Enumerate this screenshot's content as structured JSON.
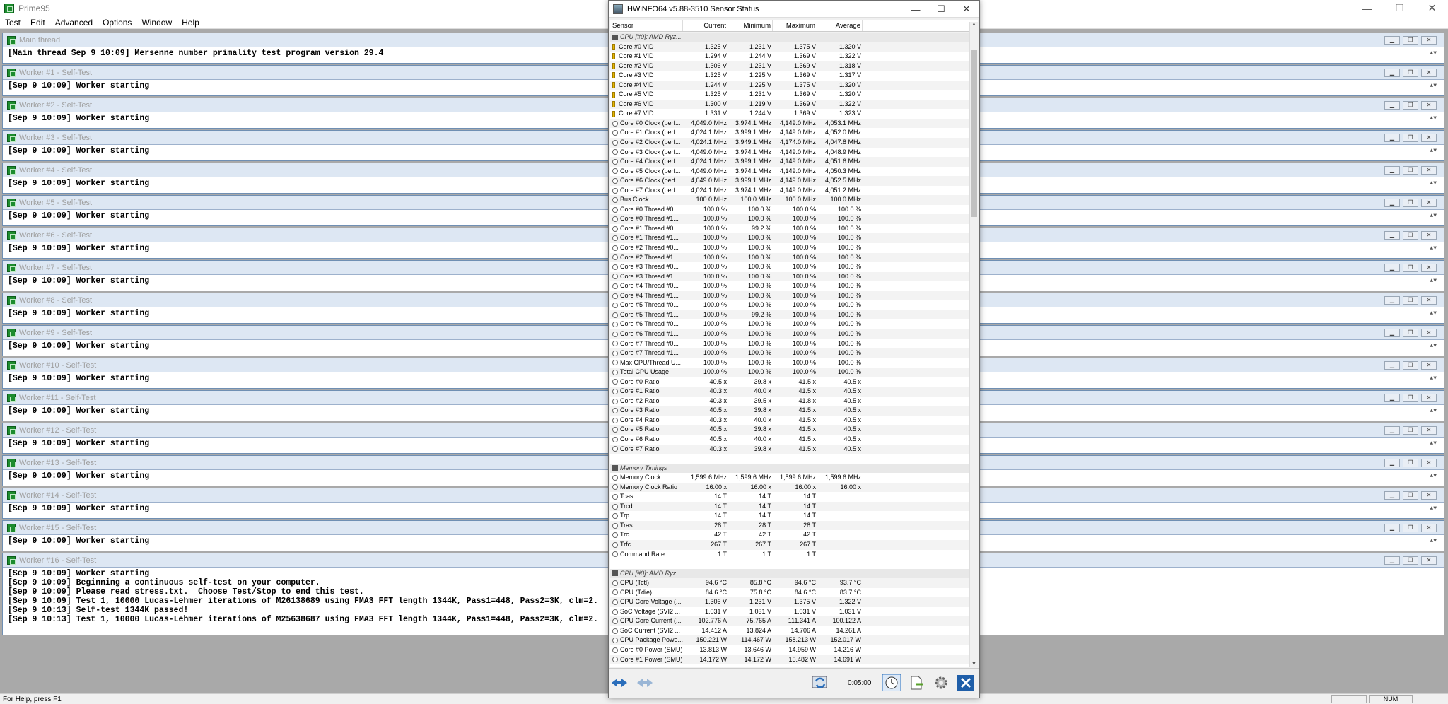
{
  "prime95": {
    "title": "Prime95",
    "menu": [
      "Test",
      "Edit",
      "Advanced",
      "Options",
      "Window",
      "Help"
    ],
    "windows": [
      {
        "title": "Main thread",
        "lines": [
          "[Main thread Sep 9 10:09] Mersenne number primality test program version 29.4"
        ]
      },
      {
        "title": "Worker #1 - Self-Test",
        "lines": [
          "[Sep 9 10:09] Worker starting"
        ]
      },
      {
        "title": "Worker #2 - Self-Test",
        "lines": [
          "[Sep 9 10:09] Worker starting"
        ]
      },
      {
        "title": "Worker #3 - Self-Test",
        "lines": [
          "[Sep 9 10:09] Worker starting"
        ]
      },
      {
        "title": "Worker #4 - Self-Test",
        "lines": [
          "[Sep 9 10:09] Worker starting"
        ]
      },
      {
        "title": "Worker #5 - Self-Test",
        "lines": [
          "[Sep 9 10:09] Worker starting"
        ]
      },
      {
        "title": "Worker #6 - Self-Test",
        "lines": [
          "[Sep 9 10:09] Worker starting"
        ]
      },
      {
        "title": "Worker #7 - Self-Test",
        "lines": [
          "[Sep 9 10:09] Worker starting"
        ]
      },
      {
        "title": "Worker #8 - Self-Test",
        "lines": [
          "[Sep 9 10:09] Worker starting"
        ]
      },
      {
        "title": "Worker #9 - Self-Test",
        "lines": [
          "[Sep 9 10:09] Worker starting"
        ]
      },
      {
        "title": "Worker #10 - Self-Test",
        "lines": [
          "[Sep 9 10:09] Worker starting"
        ]
      },
      {
        "title": "Worker #11 - Self-Test",
        "lines": [
          "[Sep 9 10:09] Worker starting"
        ]
      },
      {
        "title": "Worker #12 - Self-Test",
        "lines": [
          "[Sep 9 10:09] Worker starting"
        ]
      },
      {
        "title": "Worker #13 - Self-Test",
        "lines": [
          "[Sep 9 10:09] Worker starting"
        ]
      },
      {
        "title": "Worker #14 - Self-Test",
        "lines": [
          "[Sep 9 10:09] Worker starting"
        ]
      },
      {
        "title": "Worker #15 - Self-Test",
        "lines": [
          "[Sep 9 10:09] Worker starting"
        ]
      },
      {
        "title": "Worker #16 - Self-Test",
        "lines": [
          "[Sep 9 10:09] Worker starting",
          "[Sep 9 10:09] Beginning a continuous self-test on your computer.",
          "[Sep 9 10:09] Please read stress.txt.  Choose Test/Stop to end this test.",
          "[Sep 9 10:09] Test 1, 10000 Lucas-Lehmer iterations of M26138689 using FMA3 FFT length 1344K, Pass1=448, Pass2=3K, clm=2.",
          "[Sep 9 10:13] Self-test 1344K passed!",
          "[Sep 9 10:13] Test 1, 10000 Lucas-Lehmer iterations of M25638687 using FMA3 FFT length 1344K, Pass1=448, Pass2=3K, clm=2."
        ]
      }
    ],
    "status_text": "For Help, press F1",
    "status_num": "NUM"
  },
  "hwinfo": {
    "title": "HWiNFO64 v5.88-3510 Sensor Status",
    "columns": [
      "Sensor",
      "Current",
      "Minimum",
      "Maximum",
      "Average"
    ],
    "rows": [
      {
        "t": "grp",
        "s": "CPU [#0]: AMD Ryz...",
        "v": [
          "",
          "",
          "",
          ""
        ]
      },
      {
        "t": "volt",
        "s": "Core #0 VID",
        "v": [
          "1.325 V",
          "1.231 V",
          "1.375 V",
          "1.320 V"
        ]
      },
      {
        "t": "volt",
        "s": "Core #1 VID",
        "v": [
          "1.294 V",
          "1.244 V",
          "1.369 V",
          "1.322 V"
        ]
      },
      {
        "t": "volt",
        "s": "Core #2 VID",
        "v": [
          "1.306 V",
          "1.231 V",
          "1.369 V",
          "1.318 V"
        ]
      },
      {
        "t": "volt",
        "s": "Core #3 VID",
        "v": [
          "1.325 V",
          "1.225 V",
          "1.369 V",
          "1.317 V"
        ]
      },
      {
        "t": "volt",
        "s": "Core #4 VID",
        "v": [
          "1.244 V",
          "1.225 V",
          "1.375 V",
          "1.320 V"
        ]
      },
      {
        "t": "volt",
        "s": "Core #5 VID",
        "v": [
          "1.325 V",
          "1.231 V",
          "1.369 V",
          "1.320 V"
        ]
      },
      {
        "t": "volt",
        "s": "Core #6 VID",
        "v": [
          "1.300 V",
          "1.219 V",
          "1.369 V",
          "1.322 V"
        ]
      },
      {
        "t": "volt",
        "s": "Core #7 VID",
        "v": [
          "1.331 V",
          "1.244 V",
          "1.369 V",
          "1.323 V"
        ]
      },
      {
        "t": "clock",
        "s": "Core #0 Clock (perf...",
        "v": [
          "4,049.0 MHz",
          "3,974.1 MHz",
          "4,149.0 MHz",
          "4,053.1 MHz"
        ]
      },
      {
        "t": "clock",
        "s": "Core #1 Clock (perf...",
        "v": [
          "4,024.1 MHz",
          "3,999.1 MHz",
          "4,149.0 MHz",
          "4,052.0 MHz"
        ]
      },
      {
        "t": "clock",
        "s": "Core #2 Clock (perf...",
        "v": [
          "4,024.1 MHz",
          "3,949.1 MHz",
          "4,174.0 MHz",
          "4,047.8 MHz"
        ]
      },
      {
        "t": "clock",
        "s": "Core #3 Clock (perf...",
        "v": [
          "4,049.0 MHz",
          "3,974.1 MHz",
          "4,149.0 MHz",
          "4,048.9 MHz"
        ]
      },
      {
        "t": "clock",
        "s": "Core #4 Clock (perf...",
        "v": [
          "4,024.1 MHz",
          "3,999.1 MHz",
          "4,149.0 MHz",
          "4,051.6 MHz"
        ]
      },
      {
        "t": "clock",
        "s": "Core #5 Clock (perf...",
        "v": [
          "4,049.0 MHz",
          "3,974.1 MHz",
          "4,149.0 MHz",
          "4,050.3 MHz"
        ]
      },
      {
        "t": "clock",
        "s": "Core #6 Clock (perf...",
        "v": [
          "4,049.0 MHz",
          "3,999.1 MHz",
          "4,149.0 MHz",
          "4,052.5 MHz"
        ]
      },
      {
        "t": "clock",
        "s": "Core #7 Clock (perf...",
        "v": [
          "4,024.1 MHz",
          "3,974.1 MHz",
          "4,149.0 MHz",
          "4,051.2 MHz"
        ]
      },
      {
        "t": "clock",
        "s": "Bus Clock",
        "v": [
          "100.0 MHz",
          "100.0 MHz",
          "100.0 MHz",
          "100.0 MHz"
        ]
      },
      {
        "t": "clock",
        "s": "Core #0 Thread #0...",
        "v": [
          "100.0 %",
          "100.0 %",
          "100.0 %",
          "100.0 %"
        ]
      },
      {
        "t": "clock",
        "s": "Core #0 Thread #1...",
        "v": [
          "100.0 %",
          "100.0 %",
          "100.0 %",
          "100.0 %"
        ]
      },
      {
        "t": "clock",
        "s": "Core #1 Thread #0...",
        "v": [
          "100.0 %",
          "99.2 %",
          "100.0 %",
          "100.0 %"
        ]
      },
      {
        "t": "clock",
        "s": "Core #1 Thread #1...",
        "v": [
          "100.0 %",
          "100.0 %",
          "100.0 %",
          "100.0 %"
        ]
      },
      {
        "t": "clock",
        "s": "Core #2 Thread #0...",
        "v": [
          "100.0 %",
          "100.0 %",
          "100.0 %",
          "100.0 %"
        ]
      },
      {
        "t": "clock",
        "s": "Core #2 Thread #1...",
        "v": [
          "100.0 %",
          "100.0 %",
          "100.0 %",
          "100.0 %"
        ]
      },
      {
        "t": "clock",
        "s": "Core #3 Thread #0...",
        "v": [
          "100.0 %",
          "100.0 %",
          "100.0 %",
          "100.0 %"
        ]
      },
      {
        "t": "clock",
        "s": "Core #3 Thread #1...",
        "v": [
          "100.0 %",
          "100.0 %",
          "100.0 %",
          "100.0 %"
        ]
      },
      {
        "t": "clock",
        "s": "Core #4 Thread #0...",
        "v": [
          "100.0 %",
          "100.0 %",
          "100.0 %",
          "100.0 %"
        ]
      },
      {
        "t": "clock",
        "s": "Core #4 Thread #1...",
        "v": [
          "100.0 %",
          "100.0 %",
          "100.0 %",
          "100.0 %"
        ]
      },
      {
        "t": "clock",
        "s": "Core #5 Thread #0...",
        "v": [
          "100.0 %",
          "100.0 %",
          "100.0 %",
          "100.0 %"
        ]
      },
      {
        "t": "clock",
        "s": "Core #5 Thread #1...",
        "v": [
          "100.0 %",
          "99.2 %",
          "100.0 %",
          "100.0 %"
        ]
      },
      {
        "t": "clock",
        "s": "Core #6 Thread #0...",
        "v": [
          "100.0 %",
          "100.0 %",
          "100.0 %",
          "100.0 %"
        ]
      },
      {
        "t": "clock",
        "s": "Core #6 Thread #1...",
        "v": [
          "100.0 %",
          "100.0 %",
          "100.0 %",
          "100.0 %"
        ]
      },
      {
        "t": "clock",
        "s": "Core #7 Thread #0...",
        "v": [
          "100.0 %",
          "100.0 %",
          "100.0 %",
          "100.0 %"
        ]
      },
      {
        "t": "clock",
        "s": "Core #7 Thread #1...",
        "v": [
          "100.0 %",
          "100.0 %",
          "100.0 %",
          "100.0 %"
        ]
      },
      {
        "t": "clock",
        "s": "Max CPU/Thread U...",
        "v": [
          "100.0 %",
          "100.0 %",
          "100.0 %",
          "100.0 %"
        ]
      },
      {
        "t": "clock",
        "s": "Total CPU Usage",
        "v": [
          "100.0 %",
          "100.0 %",
          "100.0 %",
          "100.0 %"
        ]
      },
      {
        "t": "clock",
        "s": "Core #0 Ratio",
        "v": [
          "40.5 x",
          "39.8 x",
          "41.5 x",
          "40.5 x"
        ]
      },
      {
        "t": "clock",
        "s": "Core #1 Ratio",
        "v": [
          "40.3 x",
          "40.0 x",
          "41.5 x",
          "40.5 x"
        ]
      },
      {
        "t": "clock",
        "s": "Core #2 Ratio",
        "v": [
          "40.3 x",
          "39.5 x",
          "41.8 x",
          "40.5 x"
        ]
      },
      {
        "t": "clock",
        "s": "Core #3 Ratio",
        "v": [
          "40.5 x",
          "39.8 x",
          "41.5 x",
          "40.5 x"
        ]
      },
      {
        "t": "clock",
        "s": "Core #4 Ratio",
        "v": [
          "40.3 x",
          "40.0 x",
          "41.5 x",
          "40.5 x"
        ]
      },
      {
        "t": "clock",
        "s": "Core #5 Ratio",
        "v": [
          "40.5 x",
          "39.8 x",
          "41.5 x",
          "40.5 x"
        ]
      },
      {
        "t": "clock",
        "s": "Core #6 Ratio",
        "v": [
          "40.5 x",
          "40.0 x",
          "41.5 x",
          "40.5 x"
        ]
      },
      {
        "t": "clock",
        "s": "Core #7 Ratio",
        "v": [
          "40.3 x",
          "39.8 x",
          "41.5 x",
          "40.5 x"
        ]
      },
      {
        "t": "blank",
        "s": "",
        "v": [
          "",
          "",
          "",
          ""
        ]
      },
      {
        "t": "grp",
        "s": "Memory Timings",
        "v": [
          "",
          "",
          "",
          ""
        ]
      },
      {
        "t": "clock",
        "s": "Memory Clock",
        "v": [
          "1,599.6 MHz",
          "1,599.6 MHz",
          "1,599.6 MHz",
          "1,599.6 MHz"
        ]
      },
      {
        "t": "clock",
        "s": "Memory Clock Ratio",
        "v": [
          "16.00 x",
          "16.00 x",
          "16.00 x",
          "16.00 x"
        ]
      },
      {
        "t": "clock",
        "s": "Tcas",
        "v": [
          "14 T",
          "14 T",
          "14 T",
          ""
        ]
      },
      {
        "t": "clock",
        "s": "Trcd",
        "v": [
          "14 T",
          "14 T",
          "14 T",
          ""
        ]
      },
      {
        "t": "clock",
        "s": "Trp",
        "v": [
          "14 T",
          "14 T",
          "14 T",
          ""
        ]
      },
      {
        "t": "clock",
        "s": "Tras",
        "v": [
          "28 T",
          "28 T",
          "28 T",
          ""
        ]
      },
      {
        "t": "clock",
        "s": "Trc",
        "v": [
          "42 T",
          "42 T",
          "42 T",
          ""
        ]
      },
      {
        "t": "clock",
        "s": "Trfc",
        "v": [
          "267 T",
          "267 T",
          "267 T",
          ""
        ]
      },
      {
        "t": "clock",
        "s": "Command Rate",
        "v": [
          "1 T",
          "1 T",
          "1 T",
          ""
        ]
      },
      {
        "t": "blank",
        "s": "",
        "v": [
          "",
          "",
          "",
          ""
        ]
      },
      {
        "t": "grp",
        "s": "CPU [#0]: AMD Ryz...",
        "v": [
          "",
          "",
          "",
          ""
        ]
      },
      {
        "t": "clock",
        "s": "CPU (Tctl)",
        "v": [
          "94.6 °C",
          "85.8 °C",
          "94.6 °C",
          "93.7 °C"
        ]
      },
      {
        "t": "clock",
        "s": "CPU (Tdie)",
        "v": [
          "84.6 °C",
          "75.8 °C",
          "84.6 °C",
          "83.7 °C"
        ]
      },
      {
        "t": "clock",
        "s": "CPU Core Voltage (...",
        "v": [
          "1.306 V",
          "1.231 V",
          "1.375 V",
          "1.322 V"
        ]
      },
      {
        "t": "clock",
        "s": "SoC Voltage (SVI2 ...",
        "v": [
          "1.031 V",
          "1.031 V",
          "1.031 V",
          "1.031 V"
        ]
      },
      {
        "t": "clock",
        "s": "CPU Core Current (...",
        "v": [
          "102.776 A",
          "75.765 A",
          "111.341 A",
          "100.122 A"
        ]
      },
      {
        "t": "clock",
        "s": "SoC Current (SVI2 ...",
        "v": [
          "14.412 A",
          "13.824 A",
          "14.706 A",
          "14.261 A"
        ]
      },
      {
        "t": "clock",
        "s": "CPU Package Powe...",
        "v": [
          "150.221 W",
          "114.467 W",
          "158.213 W",
          "152.017 W"
        ]
      },
      {
        "t": "clock",
        "s": "Core #0 Power (SMU)",
        "v": [
          "13.813 W",
          "13.646 W",
          "14.959 W",
          "14.216 W"
        ]
      },
      {
        "t": "clock",
        "s": "Core #1 Power (SMU)",
        "v": [
          "14.172 W",
          "14.172 W",
          "15.482 W",
          "14.691 W"
        ]
      }
    ],
    "timer": "0:05:00",
    "accent": "#2a6ebb"
  }
}
